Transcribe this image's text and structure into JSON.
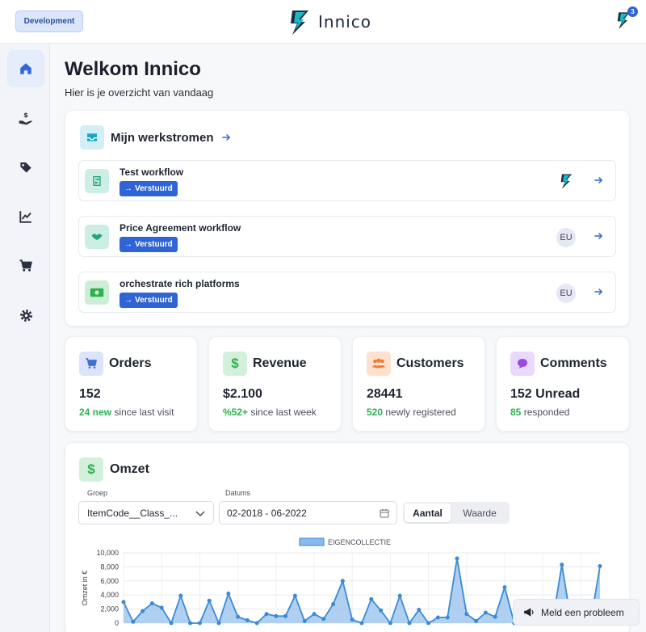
{
  "header": {
    "environment": "Development",
    "brand_name": "Innico",
    "notification_count": "3"
  },
  "sidebar": {
    "items": [
      {
        "icon": "home-icon",
        "active": true
      },
      {
        "icon": "hand-dollar-icon",
        "active": false
      },
      {
        "icon": "tag-icon",
        "active": false
      },
      {
        "icon": "chart-line-icon",
        "active": false
      },
      {
        "icon": "cart-icon",
        "active": false
      },
      {
        "icon": "gear-icon",
        "active": false
      }
    ]
  },
  "welcome": {
    "title": "Welkom Innico",
    "subtitle": "Hier is je overzicht van vandaag"
  },
  "workflows": {
    "title": "Mijn werkstromen",
    "items": [
      {
        "name": "Test workflow",
        "status": "Verstuurd",
        "assignee": "",
        "icon": "swap-icon"
      },
      {
        "name": "Price Agreement workflow",
        "status": "Verstuurd",
        "assignee": "EU",
        "icon": "handshake-icon"
      },
      {
        "name": "orchestrate rich platforms",
        "status": "Verstuurd",
        "assignee": "EU",
        "icon": "money-icon"
      }
    ]
  },
  "stats": [
    {
      "label": "Orders",
      "value": "152",
      "highlight": "24 new",
      "suffix": "since last visit",
      "icon": "cart-icon",
      "color": "#3f6ed8"
    },
    {
      "label": "Revenue",
      "value": "$2.100",
      "highlight": "%52+",
      "suffix": "since last week",
      "icon": "dollar-icon",
      "color": "#2db14f"
    },
    {
      "label": "Customers",
      "value": "28441",
      "highlight": "520",
      "suffix": "newly registered",
      "icon": "group-icon",
      "color": "#f07b33"
    },
    {
      "label": "Comments",
      "value": "152 Unread",
      "highlight": "85",
      "suffix": "responded",
      "icon": "comment-icon",
      "color": "#9a4ee0"
    }
  ],
  "omzet": {
    "title": "Omzet",
    "group_label": "Groep",
    "group_value": "ItemCode__Class_...",
    "date_label": "Datums",
    "date_value": "02-2018 - 06-2022",
    "toggle_on": "Aantal",
    "toggle_off": "Waarde"
  },
  "chart_data": {
    "type": "area",
    "legend": [
      "EIGENCOLLECTIE"
    ],
    "ylabel": "Omzet in €",
    "ylim": [
      0,
      10000
    ],
    "yticks": [
      "0",
      "2,000",
      "4,000",
      "6,000",
      "8,000",
      "10,000"
    ],
    "grid": true,
    "series": [
      {
        "name": "EIGENCOLLECTIE",
        "values": [
          3000,
          200,
          1700,
          2800,
          2200,
          0,
          3900,
          0,
          0,
          3200,
          0,
          4200,
          900,
          400,
          0,
          1300,
          1000,
          1000,
          3900,
          300,
          1300,
          600,
          2700,
          6000,
          500,
          0,
          3400,
          1800,
          0,
          3900,
          0,
          1900,
          0,
          800,
          800,
          9200,
          1300,
          300,
          1500,
          900,
          5100,
          0,
          0,
          0,
          0,
          0,
          8300,
          0,
          0,
          0,
          8100
        ]
      }
    ]
  },
  "report_button": "Meld een probleem"
}
